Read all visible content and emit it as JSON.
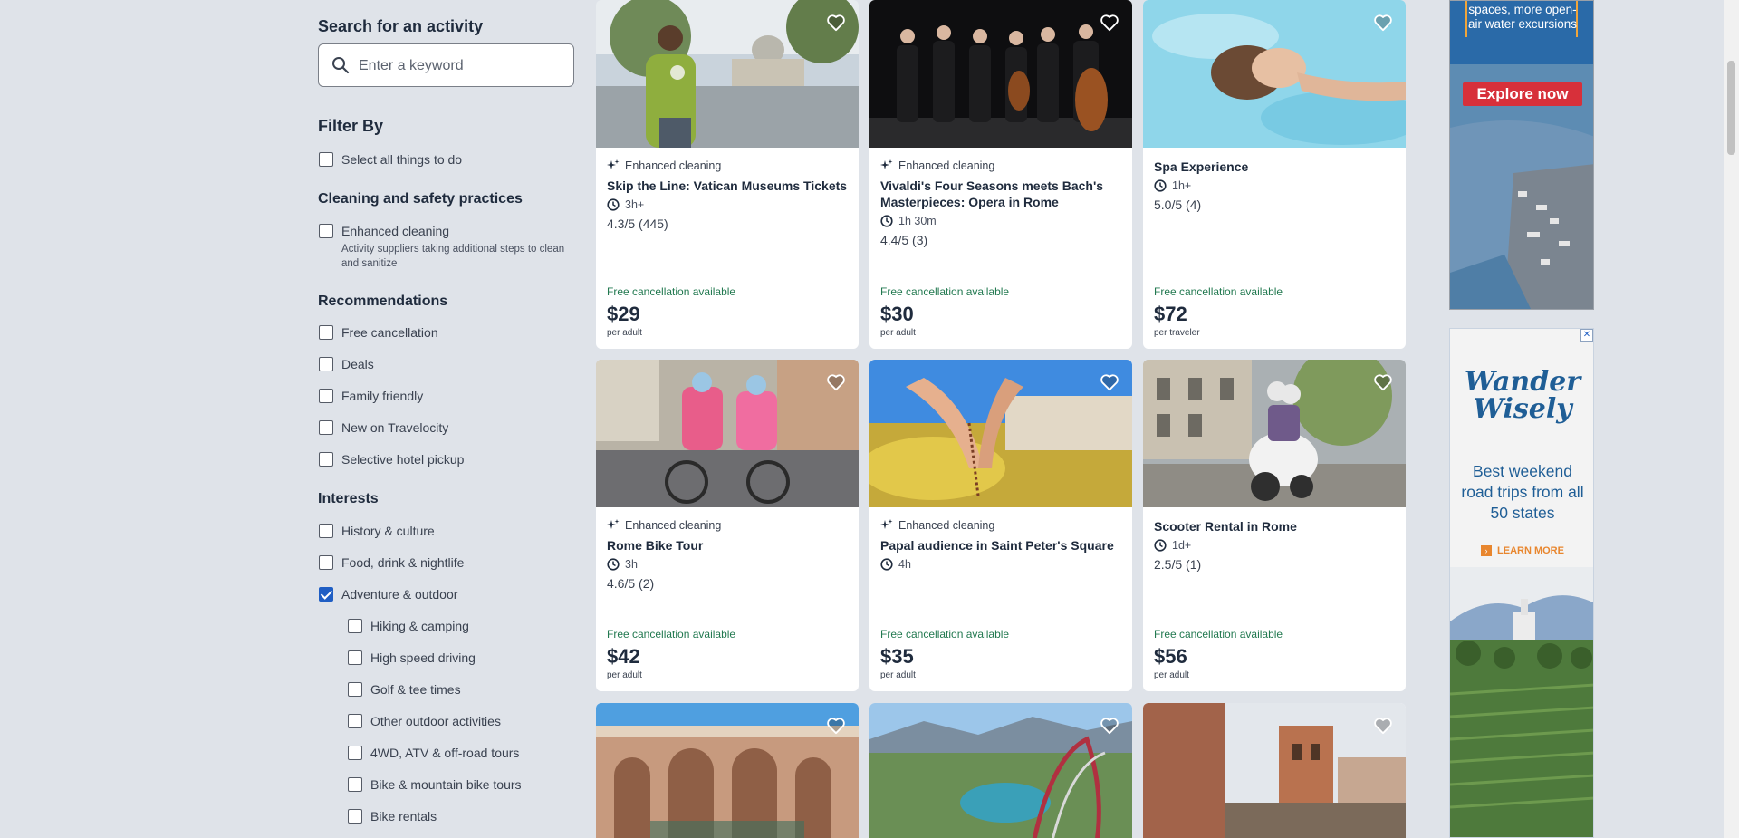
{
  "search": {
    "heading": "Search for an activity",
    "placeholder": "Enter a keyword"
  },
  "filters": {
    "heading": "Filter By",
    "select_all": "Select all things to do",
    "cleaning": {
      "heading": "Cleaning and safety practices",
      "item": "Enhanced cleaning",
      "item_desc": "Activity suppliers taking additional steps to clean and sanitize"
    },
    "recommendations": {
      "heading": "Recommendations",
      "items": [
        "Free cancellation",
        "Deals",
        "Family friendly",
        "New on Travelocity",
        "Selective hotel pickup"
      ]
    },
    "interests": {
      "heading": "Interests",
      "items": [
        "History & culture",
        "Food, drink & nightlife",
        "Adventure & outdoor"
      ],
      "sub_items": [
        "Hiking & camping",
        "High speed driving",
        "Golf & tee times",
        "Other outdoor activities",
        "4WD, ATV & off-road tours",
        "Bike & mountain bike tours",
        "Bike rentals"
      ]
    }
  },
  "cards": [
    {
      "badge": "Enhanced cleaning",
      "title": "Skip the Line: Vatican Museums Tickets",
      "duration": "3h+",
      "rating": "4.3/5",
      "reviews": "(445)",
      "free": "Free cancellation available",
      "price": "$29",
      "per": "per adult"
    },
    {
      "badge": "Enhanced cleaning",
      "title": "Vivaldi's Four Seasons meets Bach's Masterpieces: Opera in Rome",
      "duration": "1h 30m",
      "rating": "4.4/5",
      "reviews": "(3)",
      "free": "Free cancellation available",
      "price": "$30",
      "per": "per adult"
    },
    {
      "badge": "",
      "title": "Spa Experience",
      "duration": "1h+",
      "rating": "5.0/5",
      "reviews": "(4)",
      "free": "Free cancellation available",
      "price": "$72",
      "per": "per traveler"
    },
    {
      "badge": "Enhanced cleaning",
      "title": "Rome Bike Tour",
      "duration": "3h",
      "rating": "4.6/5",
      "reviews": "(2)",
      "free": "Free cancellation available",
      "price": "$42",
      "per": "per adult"
    },
    {
      "badge": "Enhanced cleaning",
      "title": "Papal audience in Saint Peter's Square",
      "duration": "4h",
      "rating": "",
      "reviews": "",
      "free": "Free cancellation available",
      "price": "$35",
      "per": "per adult"
    },
    {
      "badge": "",
      "title": "Scooter Rental in Rome",
      "duration": "1d+",
      "rating": "2.5/5",
      "reviews": "(1)",
      "free": "Free cancellation available",
      "price": "$56",
      "per": "per adult"
    }
  ],
  "ads": {
    "ad1_text": "spaces, more open-air water excursions",
    "ad1_button": "Explore now",
    "ad2_brand_line1": "Wander",
    "ad2_brand_line2": "Wisely",
    "ad2_headline": "Best weekend road trips from all 50 states",
    "ad2_cta": "LEARN MORE",
    "ad2_close": "✕"
  }
}
